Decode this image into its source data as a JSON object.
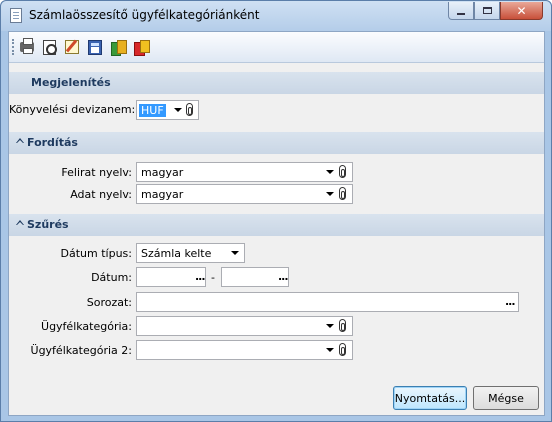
{
  "window": {
    "title": "Számlaösszesítő ügyfélkategóriánként",
    "controls": {
      "minimize": "minimize",
      "maximize": "maximize",
      "close": "✕"
    }
  },
  "toolbar": {
    "buttons": [
      "print-icon",
      "print-preview-icon",
      "edit-icon",
      "calculator-icon",
      "export-icon",
      "send-icon"
    ]
  },
  "sections": {
    "megjelenites": {
      "title": "Megjelenítés",
      "fields": {
        "currency": {
          "label": "Könyvelési devizanem:",
          "value": "HUF"
        }
      }
    },
    "forditas": {
      "title": "Fordítás",
      "fields": {
        "caption_lang": {
          "label": "Felirat nyelv:",
          "value": "magyar"
        },
        "data_lang": {
          "label": "Adat nyelv:",
          "value": "magyar"
        }
      }
    },
    "szures": {
      "title": "Szűrés",
      "fields": {
        "date_type": {
          "label": "Dátum típus:",
          "value": "Számla kelte"
        },
        "date": {
          "label": "Dátum:",
          "from": "",
          "to": "",
          "separator": "-"
        },
        "series": {
          "label": "Sorozat:",
          "value": ""
        },
        "category1": {
          "label": "Ügyfélkategória:",
          "value": ""
        },
        "category2": {
          "label": "Ügyfélkategória 2:",
          "value": ""
        }
      }
    }
  },
  "buttons": {
    "print": "Nyomtatás...",
    "cancel": "Mégse"
  },
  "colors": {
    "window_frame": "#a9c6e6",
    "section_header": "#d4dfeb",
    "section_text": "#1e3a5f",
    "selection": "#3399ff"
  }
}
